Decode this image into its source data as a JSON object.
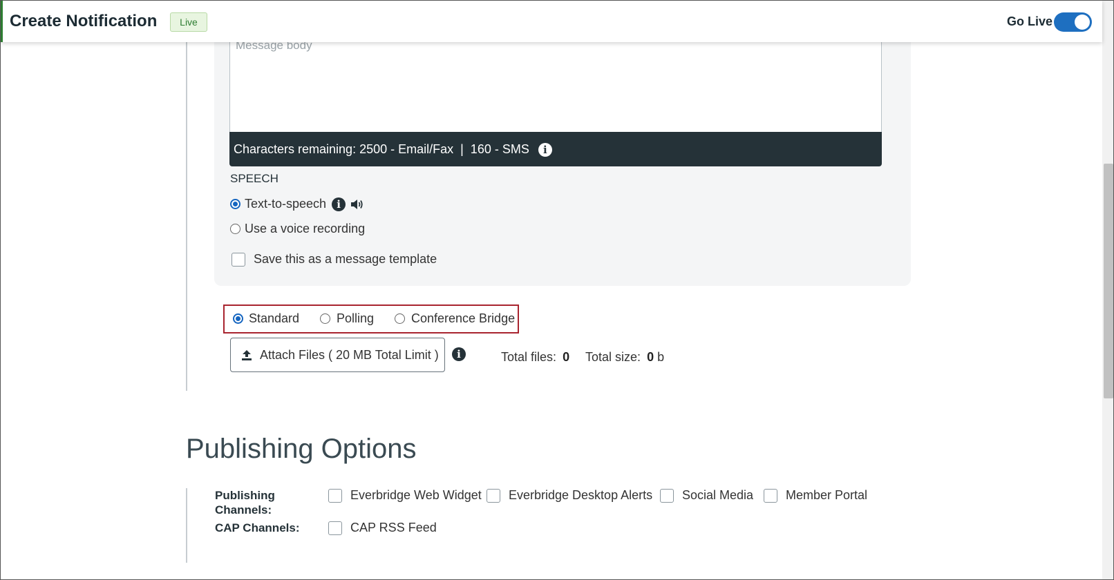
{
  "header": {
    "title": "Create Notification",
    "badge": "Live",
    "go_live_label": "Go Live",
    "go_live_enabled": true
  },
  "message": {
    "body_placeholder": "Message body",
    "chars_remaining": "Characters remaining: 2500 - Email/Fax  |  160 - SMS"
  },
  "speech": {
    "heading": "SPEECH",
    "options": [
      {
        "label": "Text-to-speech",
        "selected": true
      },
      {
        "label": "Use a voice recording",
        "selected": false
      }
    ],
    "save_template_label": "Save this as a message template"
  },
  "message_type": {
    "options": [
      {
        "label": "Standard",
        "selected": true
      },
      {
        "label": "Polling",
        "selected": false
      },
      {
        "label": "Conference Bridge",
        "selected": false
      }
    ]
  },
  "attachments": {
    "button_label": "Attach Files ( 20 MB Total Limit )",
    "total_files_label": "Total files:",
    "total_files_value": "0",
    "total_size_label": "Total size:",
    "total_size_value": "0",
    "total_size_unit": "b"
  },
  "publishing": {
    "heading": "Publishing Options",
    "channels_label": "Publishing Channels:",
    "channels": [
      {
        "label": "Everbridge Web Widget",
        "checked": false
      },
      {
        "label": "Everbridge Desktop Alerts",
        "checked": false
      },
      {
        "label": "Social Media",
        "checked": false
      },
      {
        "label": "Member Portal",
        "checked": false
      }
    ],
    "cap_label": "CAP Channels:",
    "cap_channels": [
      {
        "label": "CAP RSS Feed",
        "checked": false
      }
    ]
  },
  "colors": {
    "accent": "#1e6fc0",
    "live_green": "#2e7d32",
    "char_bar": "#253238",
    "highlight_box": "#a8232e"
  },
  "icons": [
    "info-icon",
    "speaker-icon",
    "upload-icon"
  ]
}
